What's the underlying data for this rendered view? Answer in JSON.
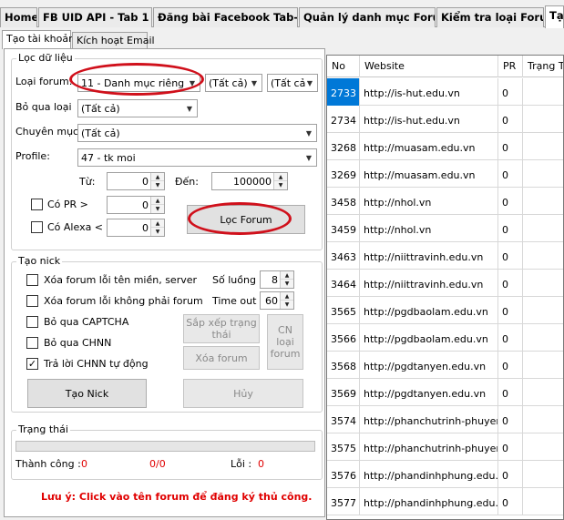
{
  "top_tabs": [
    "Home",
    "FB UID API - Tab 1",
    "Đăng bài Facebook Tab-1",
    "Quản lý danh mục Forum",
    "Kiểm tra loại Forum",
    "Tạ"
  ],
  "sub_tabs": [
    "Tạo tài khoản",
    "Kích hoạt Email"
  ],
  "filter": {
    "title": "Lọc dữ liệu",
    "loai_forum_label": "Loại forum:",
    "loai_forum_value": "11 - Danh mục riêng",
    "combo_all_1": "(Tất cả)",
    "combo_all_2": "(Tất cả",
    "bo_qua_loai_label": "Bỏ qua loại",
    "bo_qua_loai_value": "(Tất cả)",
    "chuyen_muc_label": "Chuyên mục",
    "chuyen_muc_value": "(Tất cả)",
    "profile_label": "Profile:",
    "profile_value": "47 - tk moi",
    "tu_label": "Từ:",
    "tu_value": "0",
    "den_label": "Đến:",
    "den_value": "100000",
    "co_pr_label": "Có PR >",
    "co_pr_value": "0",
    "co_alexa_label": "Có Alexa <",
    "co_alexa_value": "0",
    "filter_button": "Lọc Forum"
  },
  "nick": {
    "title": "Tạo nick",
    "checks": [
      {
        "label": "Xóa forum lỗi tên miền, server",
        "checked": false
      },
      {
        "label": "Xóa forum lỗi không phải forum",
        "checked": false
      },
      {
        "label": "Bỏ qua CAPTCHA",
        "checked": false
      },
      {
        "label": "Bỏ qua CHNN",
        "checked": false
      },
      {
        "label": "Trả lời CHNN tự động",
        "checked": true
      }
    ],
    "so_luong_label": "Số luồng",
    "so_luong_value": "8",
    "time_out_label": "Time out",
    "time_out_value": "60",
    "sort_status_button": "Sắp xếp trạng thái",
    "delete_forum_button": "Xóa forum",
    "cn_loai_forum_button": "CN loại forum",
    "create_nick_button": "Tạo Nick",
    "cancel_button": "Hủy"
  },
  "status": {
    "title": "Trạng thái",
    "progress": 0,
    "success_label": "Thành công :",
    "success_value": "0",
    "ratio_value": "0/0",
    "error_label": "Lỗi :",
    "error_value": "0"
  },
  "note": "Lưu ý: Click vào tên forum để đăng ký thủ công.",
  "grid": {
    "columns": [
      "No",
      "Website",
      "PR",
      "Trạng T"
    ],
    "rows": [
      {
        "no": "2733",
        "website": "http://is-hut.edu.vn",
        "pr": "0",
        "status": ""
      },
      {
        "no": "2734",
        "website": "http://is-hut.edu.vn",
        "pr": "0",
        "status": ""
      },
      {
        "no": "3268",
        "website": "http://muasam.edu.vn",
        "pr": "0",
        "status": ""
      },
      {
        "no": "3269",
        "website": "http://muasam.edu.vn",
        "pr": "0",
        "status": ""
      },
      {
        "no": "3458",
        "website": "http://nhol.vn",
        "pr": "0",
        "status": ""
      },
      {
        "no": "3459",
        "website": "http://nhol.vn",
        "pr": "0",
        "status": ""
      },
      {
        "no": "3463",
        "website": "http://niittravinh.edu.vn",
        "pr": "0",
        "status": ""
      },
      {
        "no": "3464",
        "website": "http://niittravinh.edu.vn",
        "pr": "0",
        "status": ""
      },
      {
        "no": "3565",
        "website": "http://pgdbaolam.edu.vn",
        "pr": "0",
        "status": ""
      },
      {
        "no": "3566",
        "website": "http://pgdbaolam.edu.vn",
        "pr": "0",
        "status": ""
      },
      {
        "no": "3568",
        "website": "http://pgdtanyen.edu.vn",
        "pr": "0",
        "status": ""
      },
      {
        "no": "3569",
        "website": "http://pgdtanyen.edu.vn",
        "pr": "0",
        "status": ""
      },
      {
        "no": "3574",
        "website": "http://phanchutrinh-phuyen...",
        "pr": "0",
        "status": ""
      },
      {
        "no": "3575",
        "website": "http://phanchutrinh-phuyen...",
        "pr": "0",
        "status": ""
      },
      {
        "no": "3576",
        "website": "http://phandinhphung.edu.vn",
        "pr": "0",
        "status": ""
      },
      {
        "no": "3577",
        "website": "http://phandinhphung.edu.vn",
        "pr": "0",
        "status": ""
      }
    ],
    "selected_index": 0
  },
  "colors": {
    "accent_red": "#d0101b",
    "selection_blue": "#0078d7"
  }
}
